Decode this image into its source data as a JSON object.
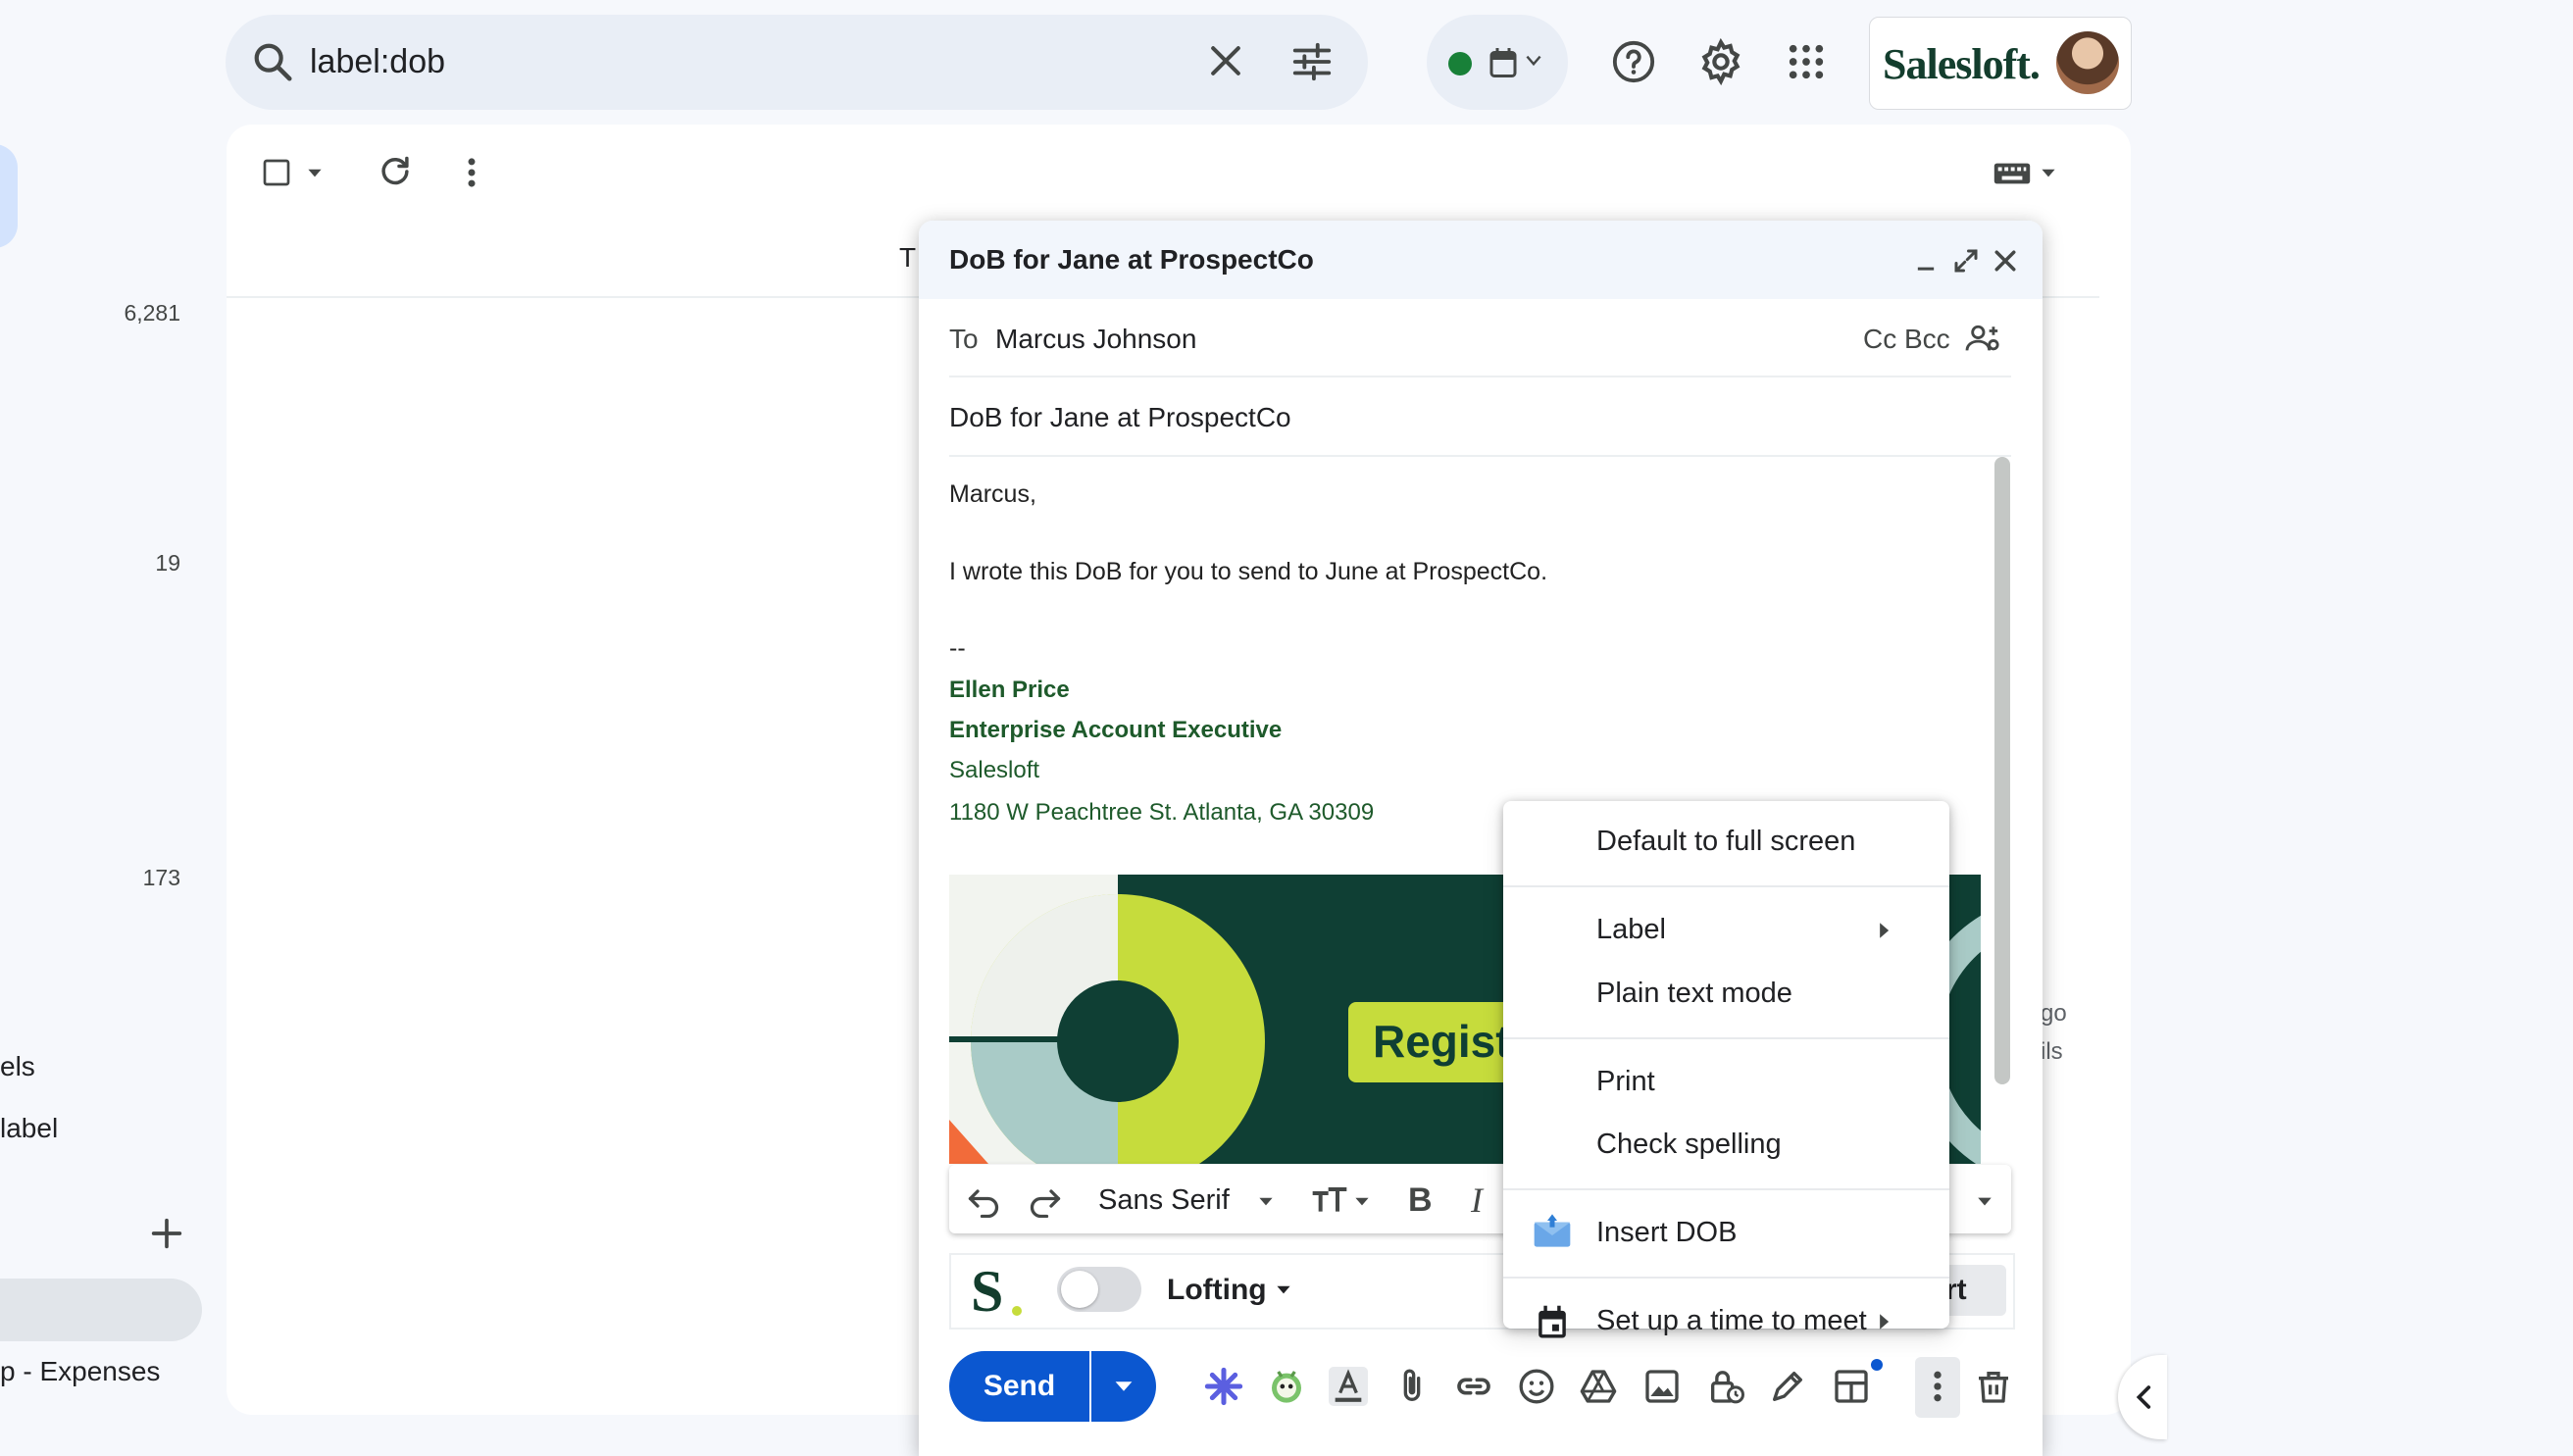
{
  "search": {
    "query": "label:dob"
  },
  "brand": {
    "name": "Salesloft."
  },
  "sidebar": {
    "counts": [
      "6,281",
      "19",
      "173"
    ],
    "texts": [
      "els",
      "label",
      "p - Expenses"
    ]
  },
  "list": {
    "partial_text": "T",
    "right_snippets": [
      "go",
      "ils"
    ]
  },
  "compose": {
    "title": "DoB for Jane at ProspectCo",
    "to_label": "To",
    "to_value": "Marcus Johnson",
    "cc_bcc": "Cc Bcc",
    "subject": "DoB for Jane at ProspectCo",
    "body": {
      "greeting": "Marcus,",
      "line1": "I wrote this DoB for you to send to June at ProspectCo.",
      "sig_sep": "--"
    },
    "signature": {
      "name": "Ellen Price",
      "title": "Enterprise Account Executive",
      "company": "Salesloft",
      "address": "1180 W Peachtree St. Atlanta, GA 30309"
    },
    "banner_text": "Regist",
    "toolbar": {
      "font": "Sans Serif",
      "bold": "B",
      "italic": "I"
    },
    "salesloft": {
      "logo": "S",
      "template": "Lofting",
      "insert_partial": "rt"
    },
    "send_label": "Send"
  },
  "menu": {
    "items": [
      {
        "label": "Default to full screen"
      },
      {
        "label": "Label"
      },
      {
        "label": "Plain text mode"
      },
      {
        "label": "Print"
      },
      {
        "label": "Check spelling"
      },
      {
        "label": "Insert DOB"
      },
      {
        "label": "Set up a time to meet"
      }
    ]
  },
  "colors": {
    "accent": "#0b57d0",
    "signature_green": "#1e5a2b",
    "brand_green": "#133d2d",
    "lime": "#c6dc3c"
  }
}
